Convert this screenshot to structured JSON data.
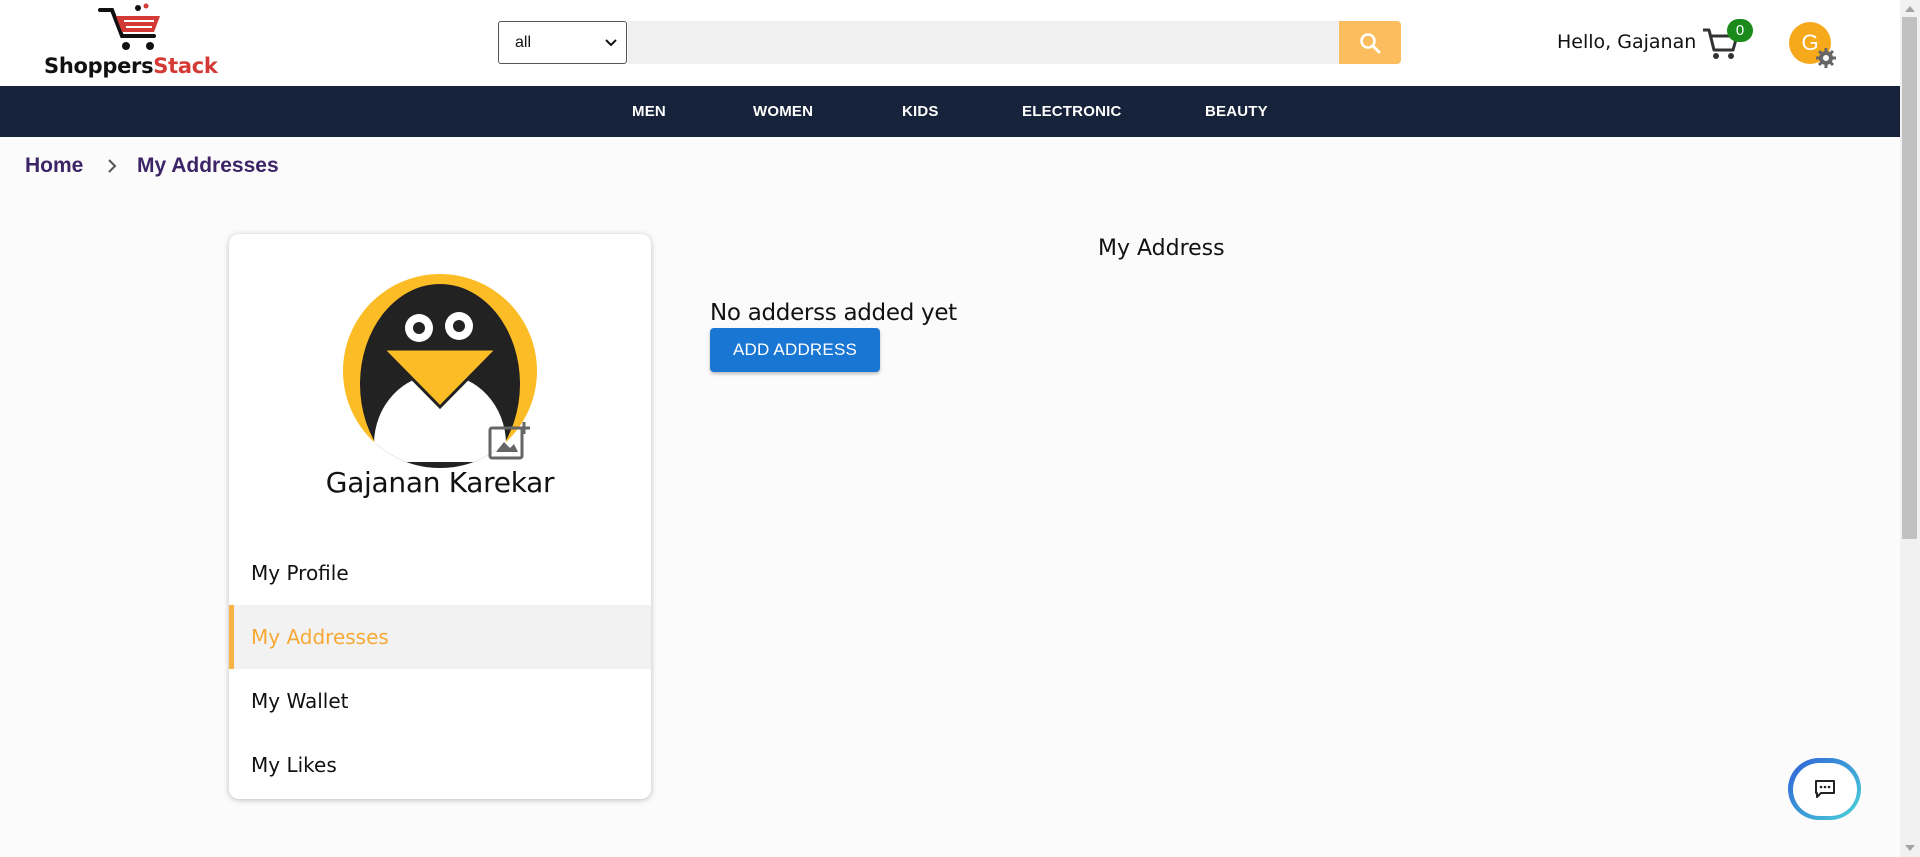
{
  "header": {
    "logo": {
      "part1": "Shoppers",
      "part2": "Stack"
    },
    "search": {
      "category_selected": "all",
      "placeholder": ""
    },
    "greeting": "Hello, Gajanan",
    "cart_count": "0",
    "avatar_initial": "G"
  },
  "nav": {
    "items": [
      "MEN",
      "WOMEN",
      "KIDS",
      "ELECTRONIC",
      "BEAUTY"
    ]
  },
  "breadcrumb": {
    "home": "Home",
    "current": "My Addresses"
  },
  "sidebar": {
    "user_name": "Gajanan Karekar",
    "menu": [
      {
        "label": "My Profile",
        "active": false
      },
      {
        "label": "My Addresses",
        "active": true
      },
      {
        "label": "My Wallet",
        "active": false
      },
      {
        "label": "My Likes",
        "active": false
      }
    ]
  },
  "main": {
    "title": "My Address",
    "empty_message": "No adderss added yet",
    "add_button": "ADD ADDRESS"
  },
  "colors": {
    "nav_bg": "#17233a",
    "accent": "#f7a936",
    "primary_button": "#1976d2",
    "search_button": "#fbbd5e",
    "cart_badge": "#1a8a1a",
    "breadcrumb_text": "#3c2466"
  },
  "icons": {
    "logo": "shopping-cart-logo",
    "search": "search-icon",
    "select": "chevron-down-icon",
    "cart": "cart-icon",
    "settings": "gear-icon",
    "breadcrumb_separator": "chevron-right-icon",
    "profile_picture": "penguin-avatar",
    "upload_photo": "add-photo-icon",
    "chat": "chat-icon"
  }
}
